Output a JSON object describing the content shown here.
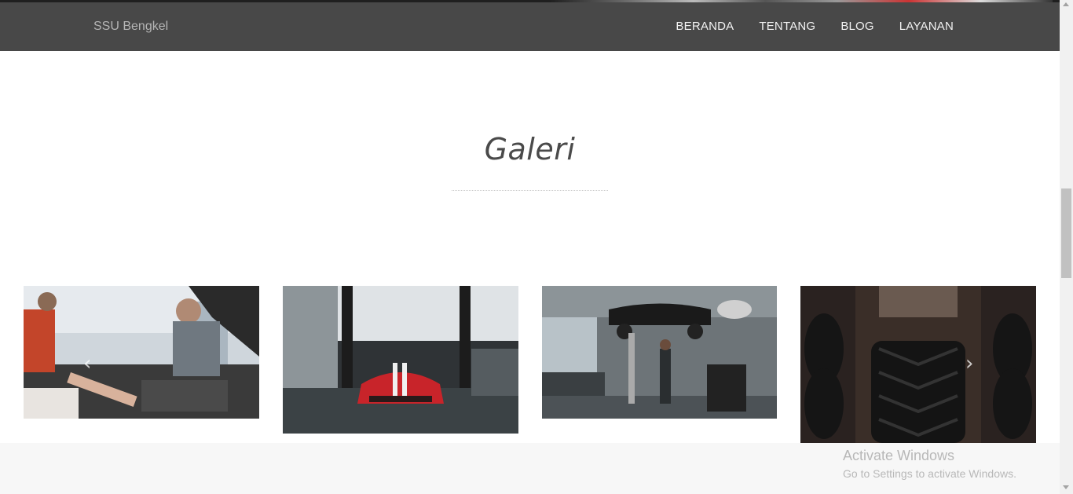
{
  "navbar": {
    "brand": "SSU Bengkel",
    "links": [
      {
        "label": "BERANDA"
      },
      {
        "label": "TENTANG"
      },
      {
        "label": "BLOG"
      },
      {
        "label": "LAYANAN"
      }
    ]
  },
  "section": {
    "title": "Galeri"
  },
  "gallery": {
    "images": [
      {
        "subject": "mechanics working on car engine"
      },
      {
        "subject": "red sports car in garage"
      },
      {
        "subject": "car on lift in workshop"
      },
      {
        "subject": "tires on rack"
      }
    ],
    "prev_icon": "chevron-left-icon",
    "next_icon": "chevron-right-icon"
  },
  "watermark": {
    "title": "Activate Windows",
    "subtitle": "Go to Settings to activate Windows."
  },
  "colors": {
    "navbar_bg": "#484848",
    "footer_bg": "#f7f7f7"
  }
}
